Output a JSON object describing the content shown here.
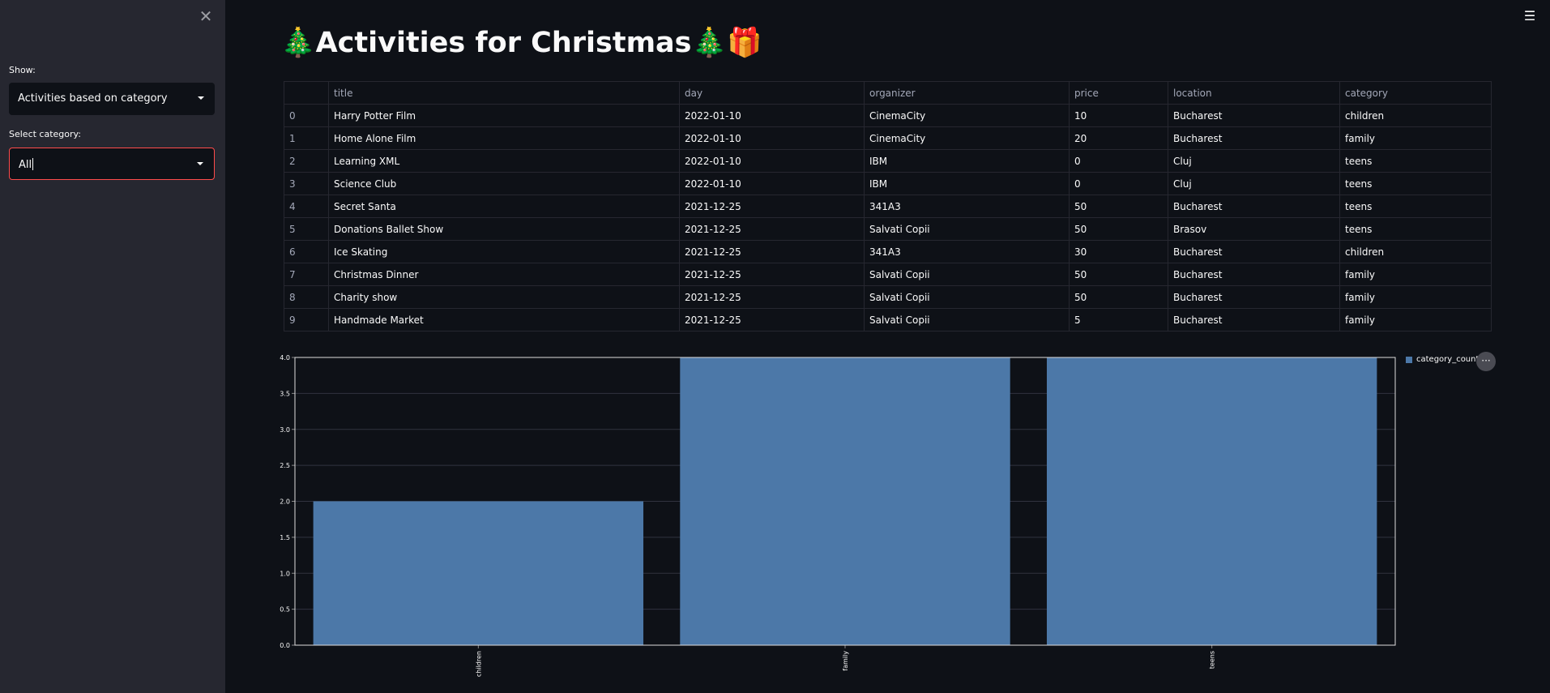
{
  "sidebar": {
    "close_icon": "close-icon",
    "show_label": "Show:",
    "show_value": "Activities based on category",
    "category_label": "Select category:",
    "category_value": "All"
  },
  "header": {
    "menu_icon": "hamburger-menu-icon",
    "title": "🎄Activities for Christmas🎄🎁"
  },
  "table": {
    "columns": [
      "",
      "title",
      "day",
      "organizer",
      "price",
      "location",
      "category"
    ],
    "rows": [
      [
        "0",
        "Harry Potter Film",
        "2022-01-10",
        "CinemaCity",
        "10",
        "Bucharest",
        "children"
      ],
      [
        "1",
        "Home Alone Film",
        "2022-01-10",
        "CinemaCity",
        "20",
        "Bucharest",
        "family"
      ],
      [
        "2",
        "Learning XML",
        "2022-01-10",
        "IBM",
        "0",
        "Cluj",
        "teens"
      ],
      [
        "3",
        "Science Club",
        "2022-01-10",
        "IBM",
        "0",
        "Cluj",
        "teens"
      ],
      [
        "4",
        "Secret Santa",
        "2021-12-25",
        "341A3",
        "50",
        "Bucharest",
        "teens"
      ],
      [
        "5",
        "Donations Ballet Show",
        "2021-12-25",
        "Salvati Copii",
        "50",
        "Brasov",
        "teens"
      ],
      [
        "6",
        "Ice Skating",
        "2021-12-25",
        "341A3",
        "30",
        "Bucharest",
        "children"
      ],
      [
        "7",
        "Christmas Dinner",
        "2021-12-25",
        "Salvati Copii",
        "50",
        "Bucharest",
        "family"
      ],
      [
        "8",
        "Charity show",
        "2021-12-25",
        "Salvati Copii",
        "50",
        "Bucharest",
        "family"
      ],
      [
        "9",
        "Handmade Market",
        "2021-12-25",
        "Salvati Copii",
        "5",
        "Bucharest",
        "family"
      ]
    ]
  },
  "chart_more_label": "···",
  "chart_data": {
    "type": "bar",
    "categories": [
      "children",
      "family",
      "teens"
    ],
    "series": [
      {
        "name": "category_count",
        "values": [
          2,
          4,
          4
        ],
        "color": "#4c78a8"
      }
    ],
    "ylim": [
      0,
      4
    ],
    "yticks": [
      "0.0",
      "0.5",
      "1.0",
      "1.5",
      "2.0",
      "2.5",
      "3.0",
      "3.5",
      "4.0"
    ],
    "grid": true,
    "legend": "top-right"
  }
}
